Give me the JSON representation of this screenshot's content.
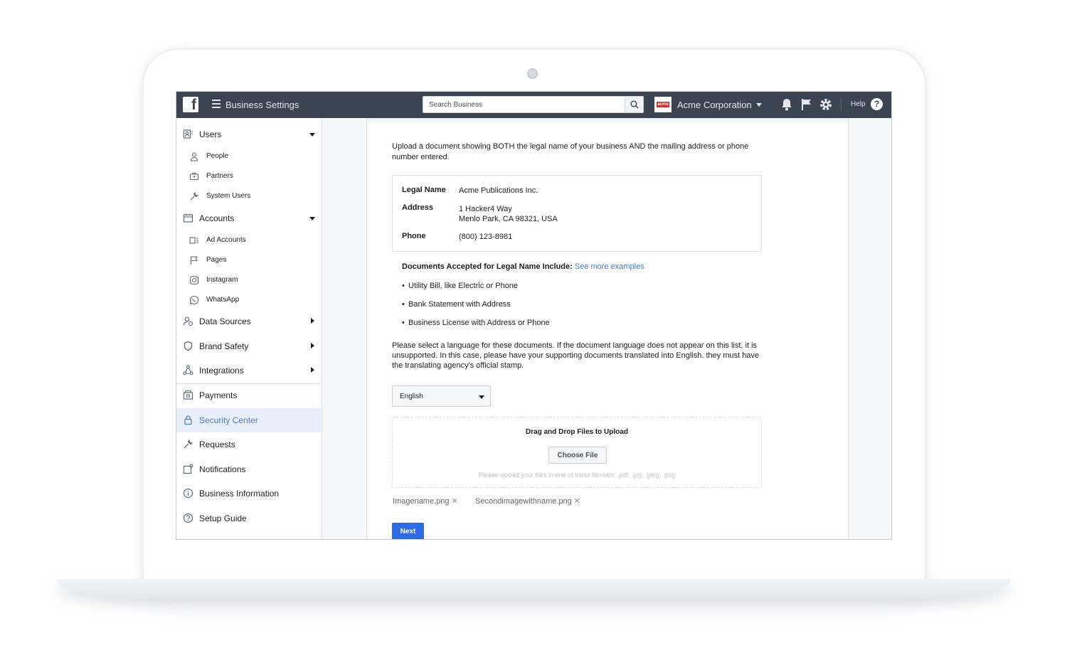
{
  "topbar": {
    "logo": "f",
    "title": "Business Settings",
    "search_placeholder": "Search Business",
    "business_name": "Acme Corporation",
    "help_label": "Help",
    "help_icon": "?",
    "bg_color": "#3b4452"
  },
  "sidebar": {
    "users": {
      "label": "Users",
      "items": [
        "People",
        "Partners",
        "System Users"
      ]
    },
    "accounts": {
      "label": "Accounts",
      "items": [
        "Ad Accounts",
        "Pages",
        "Instagram",
        "WhatsApp"
      ]
    },
    "data_sources": "Data Sources",
    "brand_safety": "Brand Safety",
    "integrations": "Integrations",
    "payments": "Payments",
    "security_center": "Security Center",
    "requests": "Requests",
    "notifications": "Notifications",
    "business_information": "Business Information",
    "setup_guide": "Setup Guide",
    "active_color": "#4a79c6"
  },
  "main": {
    "intro": "Upload a document showing BOTH the legal name of your business AND the mailing address or phone number entered.",
    "info": {
      "legal_name_label": "Legal Name",
      "legal_name": "Acme Publications Inc.",
      "address_label": "Address",
      "address_line1": "1 Hacker4 Way",
      "address_line2": "Menlo Park, CA 98321, USA",
      "phone_label": "Phone",
      "phone": "(800) 123-8981"
    },
    "docs_title": "Documents Accepted for Legal Name Include:",
    "docs_link": "See more examples",
    "docs": [
      "Utility Bill, like Electric or Phone",
      "Bank Statement with Address",
      "Business License with Address or Phone"
    ],
    "language_note": "Please select a language for these documents. If the document language does not appear on this list, it is unsupported. In this case, please have your supporting documents translated into English. they must have the translating agency's official stamp.",
    "language": "English",
    "dropzone_title": "Drag and Drop Files to Upload",
    "choose_file": "Choose File",
    "dropzone_hint": "Please upload your files in one of these formats: .pdf, .jpg, .jpeg, .png",
    "files": [
      "Imagename.png",
      "Secondimagewithname.png"
    ],
    "remove_glyph": "✕",
    "next": "Next",
    "primary_color": "#2d6ce4"
  }
}
